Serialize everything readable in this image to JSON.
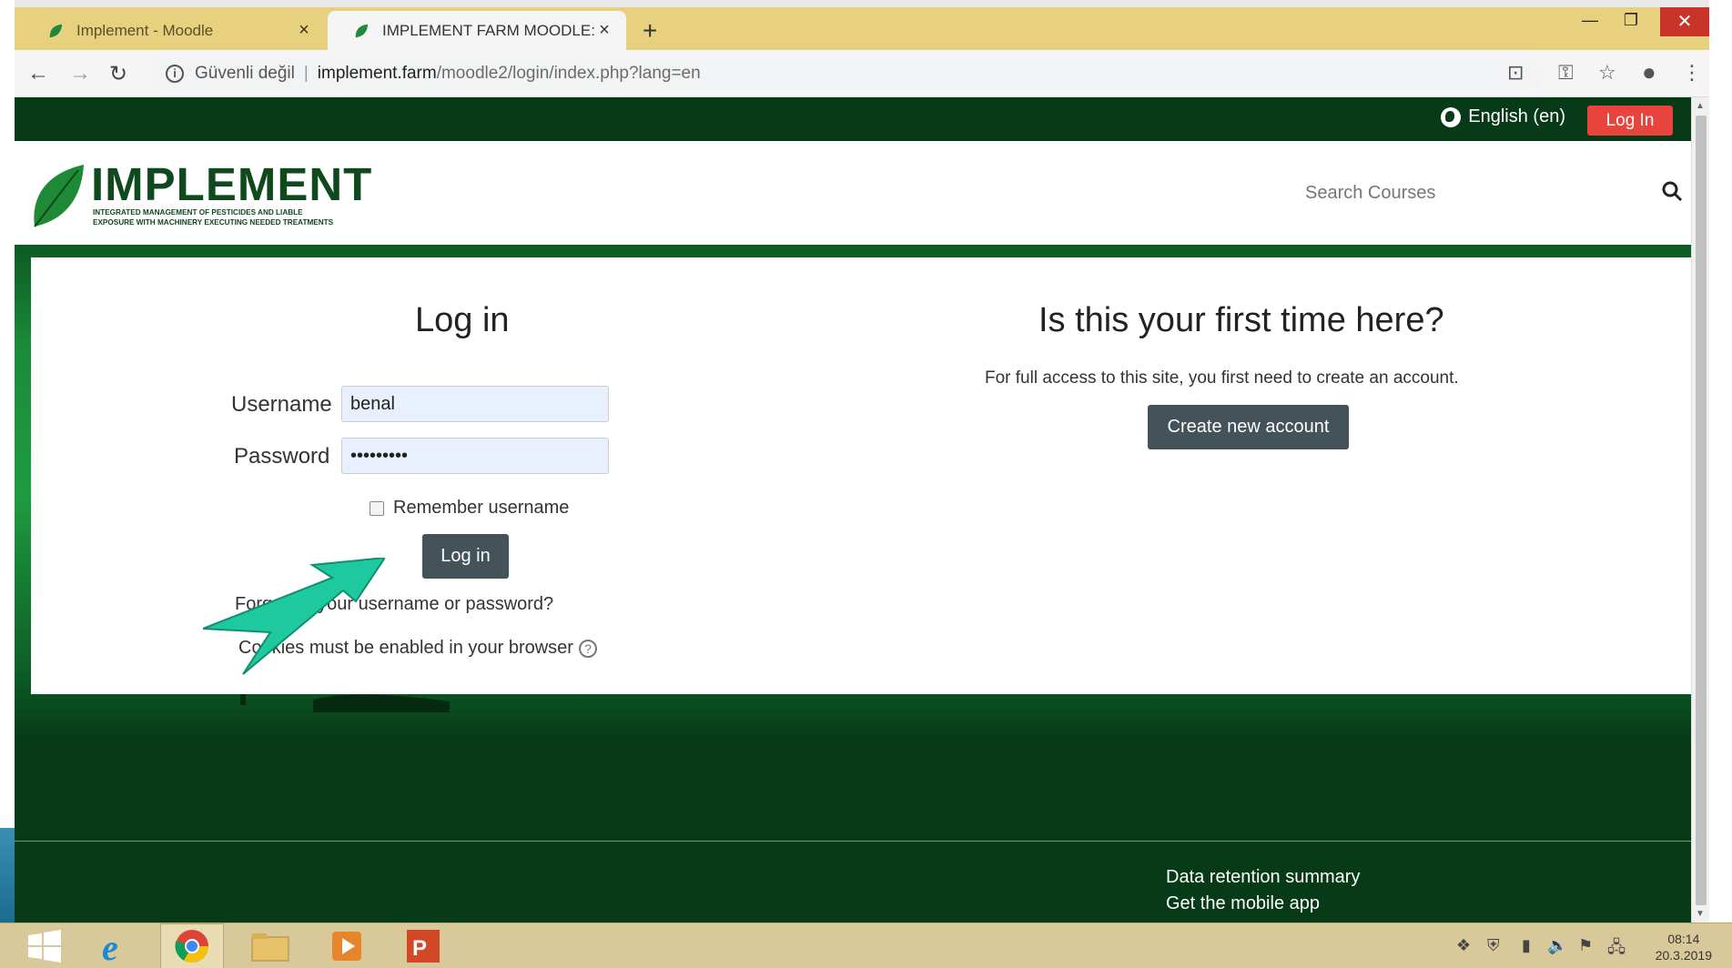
{
  "browser": {
    "tabs": [
      {
        "title": "Implement - Moodle",
        "active": false
      },
      {
        "title": "IMPLEMENT FARM MOODLE: Log",
        "active": true
      }
    ],
    "new_tab": "+",
    "close": "×",
    "security_label": "Güvenli değil",
    "url_host": "implement.farm",
    "url_path": "/moodle2/login/index.php?lang=en"
  },
  "topnav": {
    "language": "English (en)",
    "login_button": "Log In"
  },
  "header": {
    "logo_word": "IMPLEMENT",
    "logo_tag_line1": "INTEGRATED MANAGEMENT OF PESTICIDES AND LIABLE",
    "logo_tag_line2": "EXPOSURE WITH MACHINERY EXECUTING NEEDED TREATMENTS",
    "search_placeholder": "Search Courses"
  },
  "login": {
    "heading": "Log in",
    "username_label": "Username",
    "username_value": "benal",
    "password_label": "Password",
    "password_value": "•••••••••",
    "remember_label": "Remember username",
    "submit_label": "Log in",
    "forgot_link": "Forgotten your username or password?",
    "cookies_text": "Cookies must be enabled in your browser"
  },
  "signup": {
    "heading": "Is this your first time here?",
    "text": "For full access to this site, you first need to create an account.",
    "button": "Create new account"
  },
  "footer": {
    "link1": "Data retention summary",
    "link2": "Get the mobile app"
  },
  "taskbar": {
    "time": "08:14",
    "date": "20.3.2019"
  },
  "colors": {
    "nav_green": "#073a17",
    "login_red": "#e8433d",
    "button_slate": "#435359",
    "arrow_teal": "#1fc9a0"
  }
}
